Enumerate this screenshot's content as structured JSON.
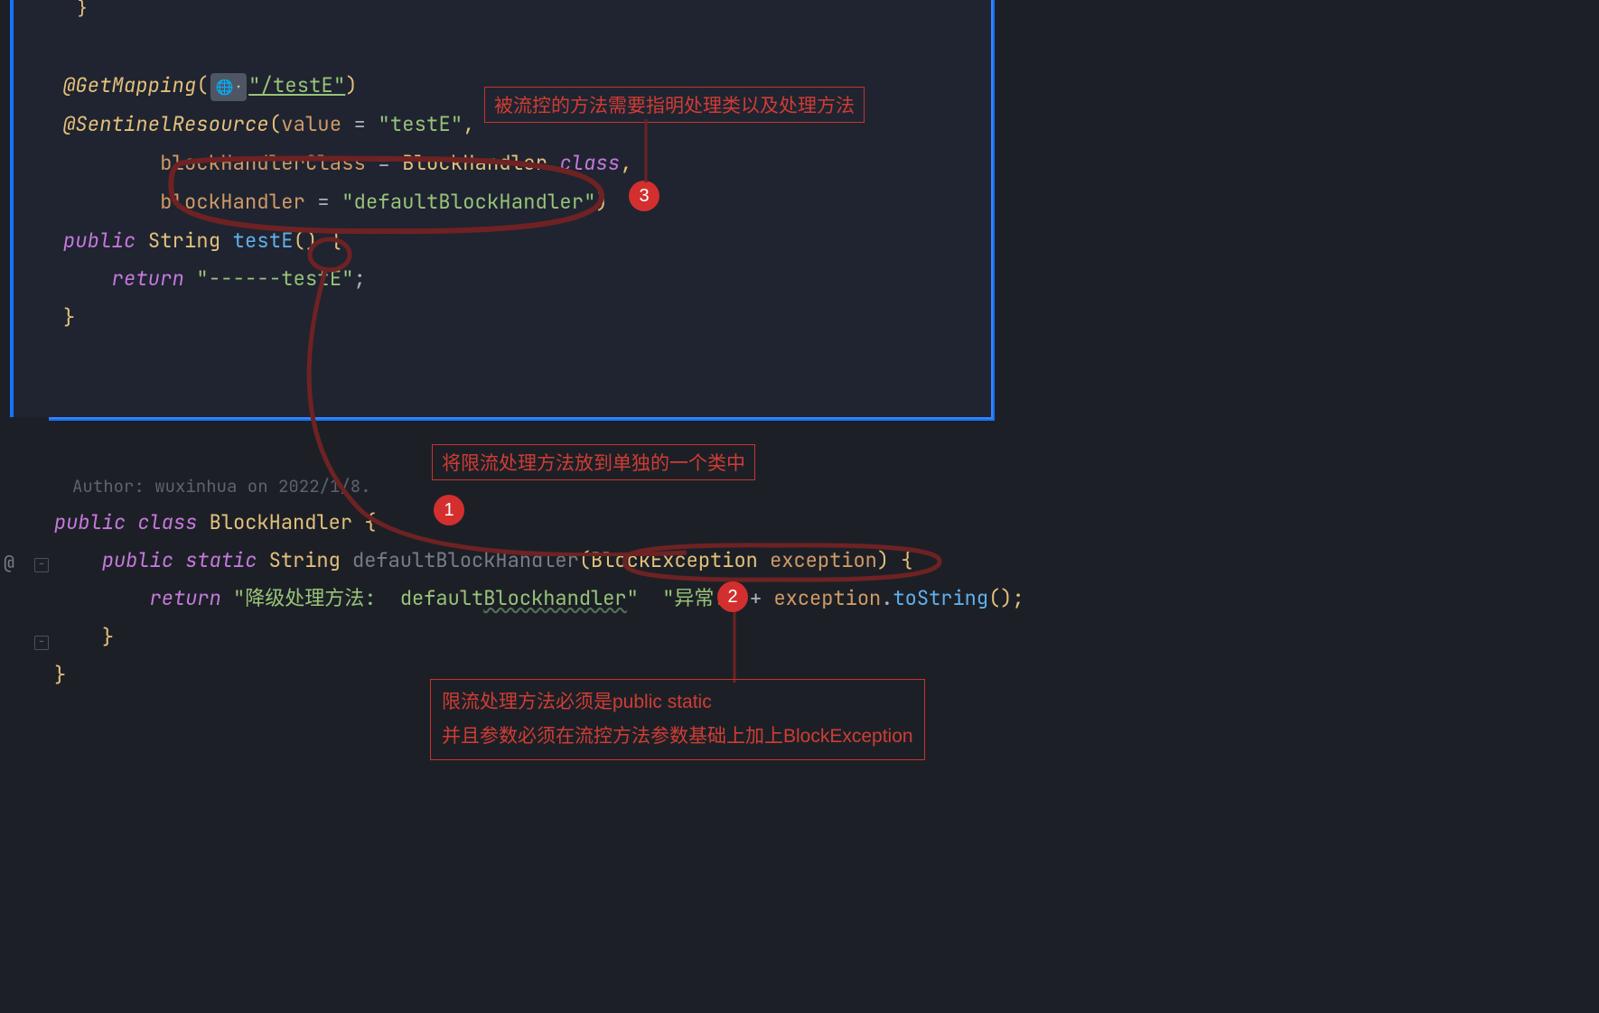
{
  "top": {
    "l1": {
      "ann": "@GetMapping",
      "lpar": "(",
      "url": "\"/testE\"",
      "rpar": ")"
    },
    "l2": {
      "ann": "@SentinelResource",
      "lpar": "(",
      "p1": "value",
      "eq": " = ",
      "v1": "\"testE\"",
      "comma": ","
    },
    "l3": {
      "p": "blockHandlerClass",
      "eq": " = ",
      "cls": "BlockHandler",
      "dot": ".",
      "classkw": "class",
      "comma": ","
    },
    "l4": {
      "p": "blockHandler",
      "eq": " = ",
      "v": "\"defaultBlockHandler\"",
      "rpar": ")"
    },
    "l5": {
      "kw": "public",
      "sp": " ",
      "type": "String",
      "sp2": " ",
      "name": "testE",
      "pp": "() ",
      "lb": "{"
    },
    "l6": {
      "kw": "return",
      "sp": " ",
      "v": "\"------testE\"",
      "semi": ";"
    },
    "l7": {
      "rb": "}"
    },
    "l0": {
      "rb": "}"
    }
  },
  "bottom": {
    "author": "Author: wuxinhua on 2022/1/8.",
    "l1": {
      "kw1": "public",
      "kw2": "class",
      "name": "BlockHandler",
      "lb": "{"
    },
    "l2": {
      "kw1": "public",
      "kw2": "static",
      "type": "String",
      "name": "defaultBlockHandler",
      "lpar": "(",
      "ptype": "BlockException",
      "pname": "exception",
      "rpar": ")",
      "lb": "{"
    },
    "l3": {
      "kw": "return",
      "s1": "\"降级处理方法:  default",
      "s1b": "Blockhandler",
      "s1c": "\"",
      "s2": "\"异常:\"",
      "plus": " + ",
      "obj": "exception",
      "dot": ".",
      "mth": "toString",
      "pp": "();"
    },
    "l4": {
      "rb": "}"
    },
    "l5": {
      "rb": "}"
    }
  },
  "notes": {
    "n3": "被流控的方法需要指明处理类以及处理方法",
    "n1": "将限流处理方法放到单独的一个类中",
    "n2a": "限流处理方法必须是public static",
    "n2b": "并且参数必须在流控方法参数基础上加上BlockException"
  },
  "bubbles": {
    "b1": "1",
    "b2": "2",
    "b3": "3"
  },
  "gutter_at": "@"
}
